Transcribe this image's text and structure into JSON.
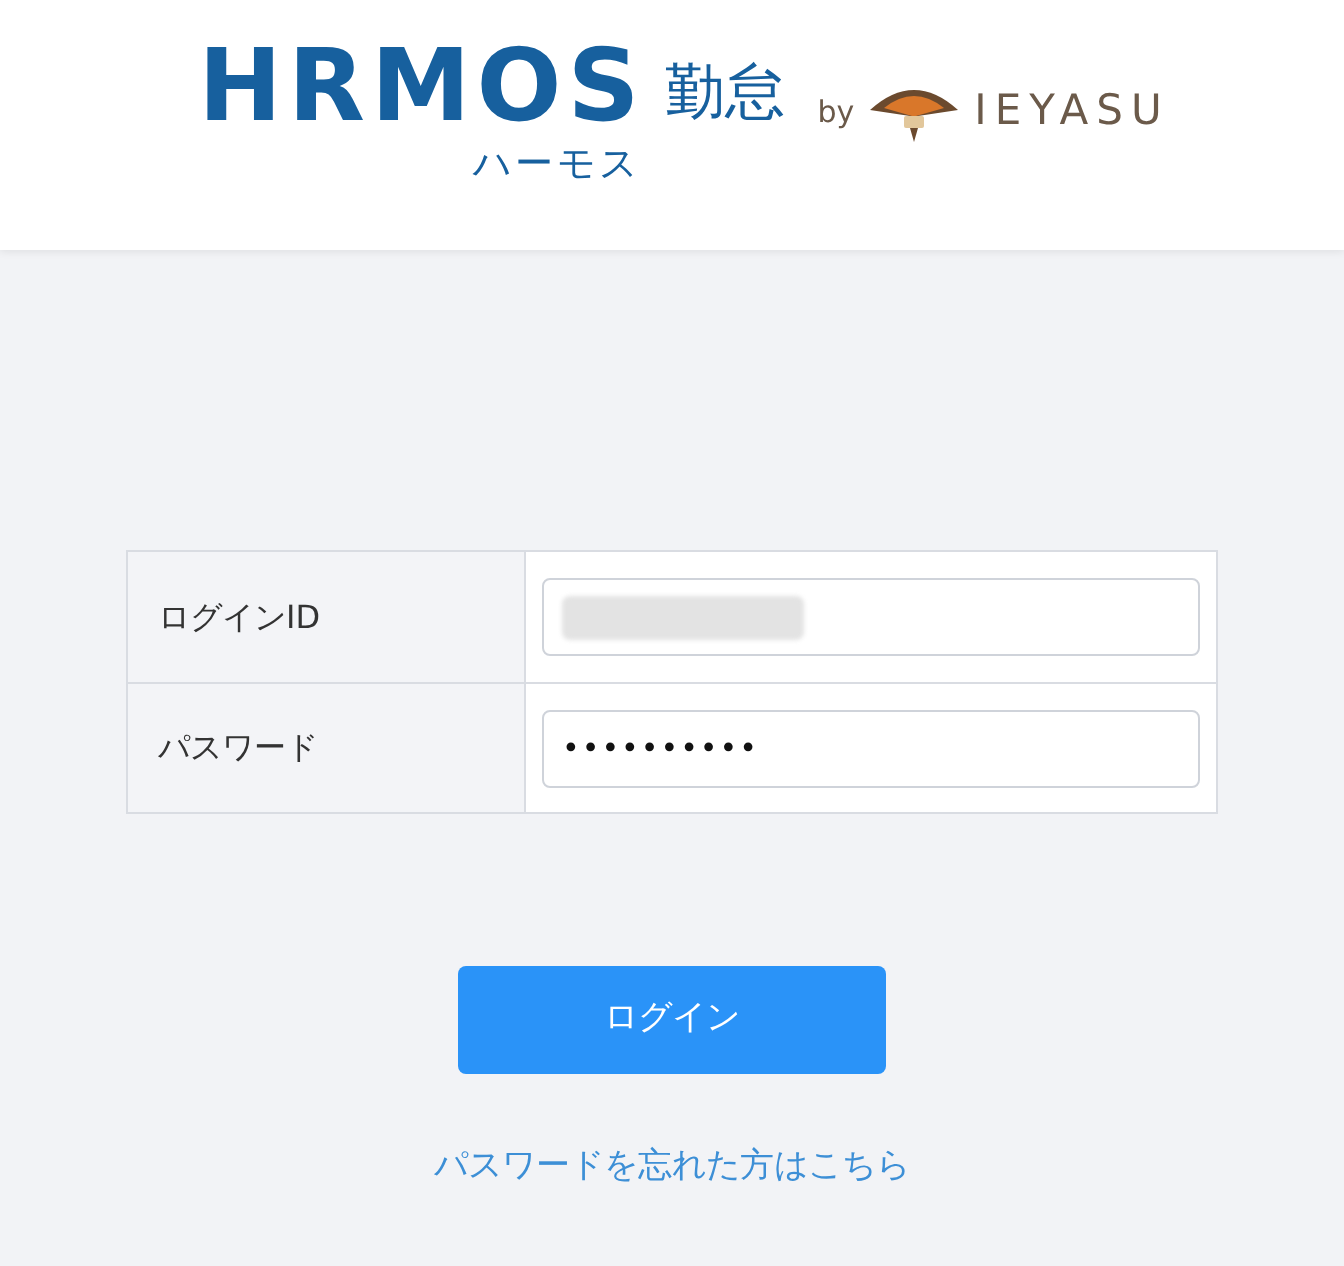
{
  "header": {
    "logo": {
      "brand": "HRMOS",
      "product": "勤怠",
      "reading": "ハーモス",
      "by": "by",
      "partner": "IEYASU"
    }
  },
  "form": {
    "fields": [
      {
        "label": "ログインID",
        "kind": "redacted"
      },
      {
        "label": "パスワード",
        "kind": "password",
        "value": "••••••••••"
      }
    ],
    "submit": "ログイン",
    "forgot_link": "パスワードを忘れた方はこちら"
  }
}
